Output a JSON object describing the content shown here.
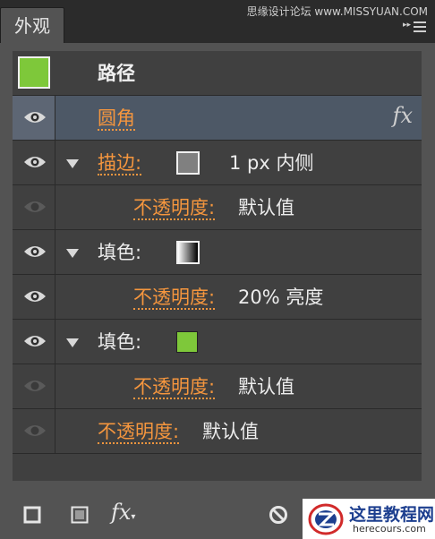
{
  "panel": {
    "tab_label": "外观",
    "watermark": "思缘设计论坛 www.MISSYUAN.COM"
  },
  "object": {
    "label": "路径",
    "thumbnail_color": "#7ec83a"
  },
  "rows": {
    "effect": {
      "label": "圆角",
      "fx_label": "fx"
    },
    "stroke": {
      "label": "描边:",
      "swatch_color": "#808080",
      "value": "1 px 内侧"
    },
    "stroke_opacity": {
      "label": "不透明度:",
      "value": "默认值"
    },
    "fill1": {
      "label": "填色:",
      "swatch": "gradient white-black"
    },
    "fill1_opacity": {
      "label": "不透明度:",
      "value": "20% 亮度"
    },
    "fill2": {
      "label": "填色:",
      "swatch_color": "#7ec83a"
    },
    "fill2_opacity": {
      "label": "不透明度:",
      "value": "默认值"
    },
    "opacity": {
      "label": "不透明度:",
      "value": "默认值"
    }
  },
  "toolbar": {
    "add_stroke_icon": "new-stroke-icon",
    "add_fill_icon": "new-fill-icon",
    "fx_label": "fx",
    "clear_icon": "clear-appearance-icon"
  },
  "badge": {
    "title": "这里教程网",
    "url": "herecours.com"
  },
  "colors": {
    "accent_orange": "#f5963e",
    "selected_row": "#4d5866",
    "panel_bg": "#404040"
  }
}
